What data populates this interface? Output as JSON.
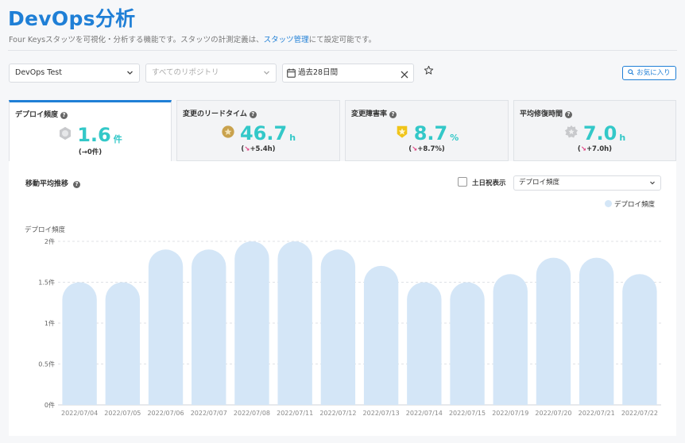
{
  "header": {
    "title": "DevOps分析",
    "subtitle_pre": "Four Keysスタッツを可視化・分析する機能です。スタッツの計測定義は、",
    "subtitle_link": "スタッツ管理",
    "subtitle_post": "にて設定可能です。"
  },
  "filters": {
    "project": "DevOps Test",
    "repository_placeholder": "すべてのリポジトリ",
    "period": "過去28日間",
    "favorite_label": "お気に入り"
  },
  "cards": [
    {
      "label": "デプロイ頻度",
      "value": "1.6",
      "unit": "件",
      "arrow": "→",
      "delta": "0件",
      "badge": "gray",
      "active": true
    },
    {
      "label": "変更のリードタイム",
      "value": "46.7",
      "unit": "h",
      "arrow": "↘",
      "delta": "+5.4h",
      "badge": "bronze",
      "active": false
    },
    {
      "label": "変更障害率",
      "value": "8.7",
      "unit": "%",
      "arrow": "↘",
      "delta": "+8.7%",
      "badge": "gold",
      "active": false
    },
    {
      "label": "平均修復時間",
      "value": "7.0",
      "unit": "h",
      "arrow": "↘",
      "delta": "+7.0h",
      "badge": "gray",
      "active": false
    }
  ],
  "panel": {
    "title": "移動平均推移",
    "weekend_label": "土日祝表示",
    "metric_select": "デプロイ頻度"
  },
  "colors": {
    "accent": "#1f7fd6",
    "value": "#33c8c8",
    "bar": "#d4e6f7",
    "delta_arrow": "#e04080"
  },
  "chart_data": {
    "type": "bar",
    "ylabel": "デプロイ頻度",
    "legend": "デプロイ頻度",
    "legend_position": "top-right",
    "grid": true,
    "ylim": [
      0,
      2
    ],
    "yticks": [
      {
        "value": 0,
        "label": "0件"
      },
      {
        "value": 0.5,
        "label": "0.5件"
      },
      {
        "value": 1,
        "label": "1件"
      },
      {
        "value": 1.5,
        "label": "1.5件"
      },
      {
        "value": 2,
        "label": "2件"
      }
    ],
    "categories": [
      "2022/07/04",
      "2022/07/05",
      "2022/07/06",
      "2022/07/07",
      "2022/07/08",
      "2022/07/11",
      "2022/07/12",
      "2022/07/13",
      "2022/07/14",
      "2022/07/15",
      "2022/07/19",
      "2022/07/20",
      "2022/07/21",
      "2022/07/22"
    ],
    "series": [
      {
        "name": "デプロイ頻度",
        "values": [
          1.5,
          1.5,
          1.9,
          1.9,
          2.0,
          2.0,
          1.9,
          1.7,
          1.5,
          1.5,
          1.6,
          1.8,
          1.8,
          1.6
        ]
      }
    ]
  }
}
